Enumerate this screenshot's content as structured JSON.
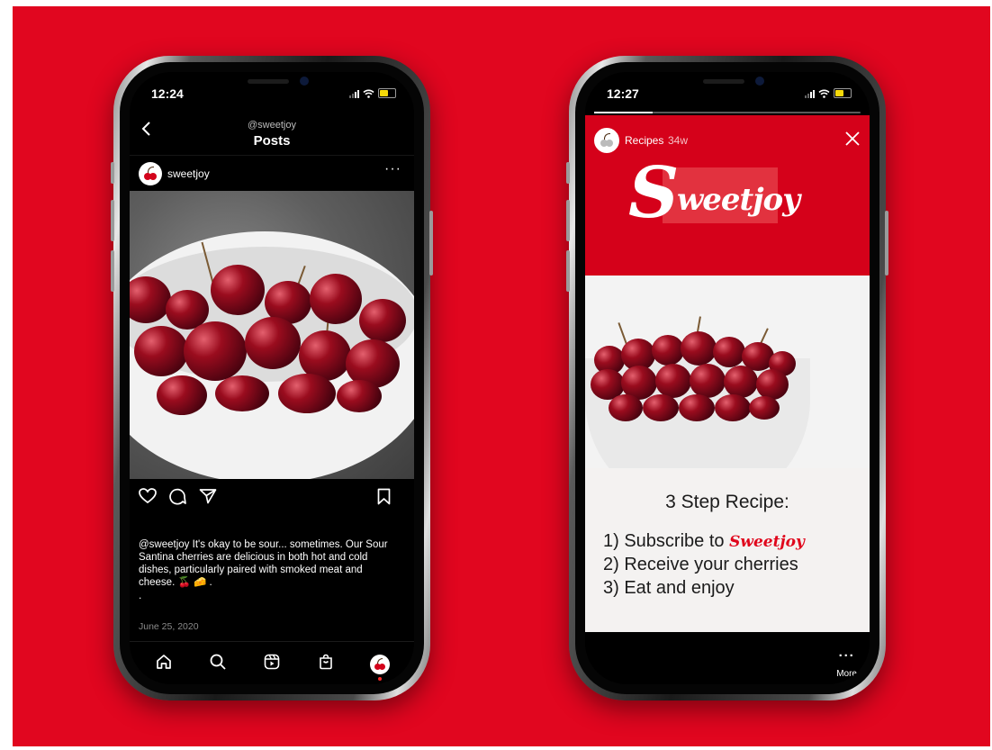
{
  "colors": {
    "background": "#e1061f",
    "brand_red": "#d5011a",
    "screen": "#000000"
  },
  "phone_left": {
    "status_time": "12:24",
    "header": {
      "username": "@sweetjoy",
      "title": "Posts",
      "back_icon": "chevron-left"
    },
    "post": {
      "username": "sweetjoy",
      "more_label": "···",
      "image_alt": "cherries in white bowl",
      "caption_handle": "@sweetjoy",
      "caption_text": "It's okay to be sour... sometimes. Our Sour Santina cherries are delicious in both hot and cold dishes, particularly paired with smoked meat and cheese. 🍒 🧀 .",
      "dot": ".",
      "date": "June 25, 2020"
    },
    "actions": [
      "heart-icon",
      "comment-icon",
      "share-icon",
      "bookmark-icon"
    ],
    "tabs": [
      "home-icon",
      "search-icon",
      "reels-icon",
      "shop-icon",
      "profile-icon"
    ]
  },
  "phone_right": {
    "status_time": "12:27",
    "story": {
      "account": "Recipes",
      "age": "34w",
      "close_label": "✕",
      "logo_first": "S",
      "logo_rest": "weetjoy",
      "title": "3 Step Recipe:",
      "step1_prefix": "1) Subscribe to",
      "step1_logo": "Sweetjoy",
      "step2": "2) Receive your cherries",
      "step3": "3) Eat and enjoy",
      "progress": 0.22
    },
    "more": {
      "dots": "···",
      "label": "More"
    }
  }
}
